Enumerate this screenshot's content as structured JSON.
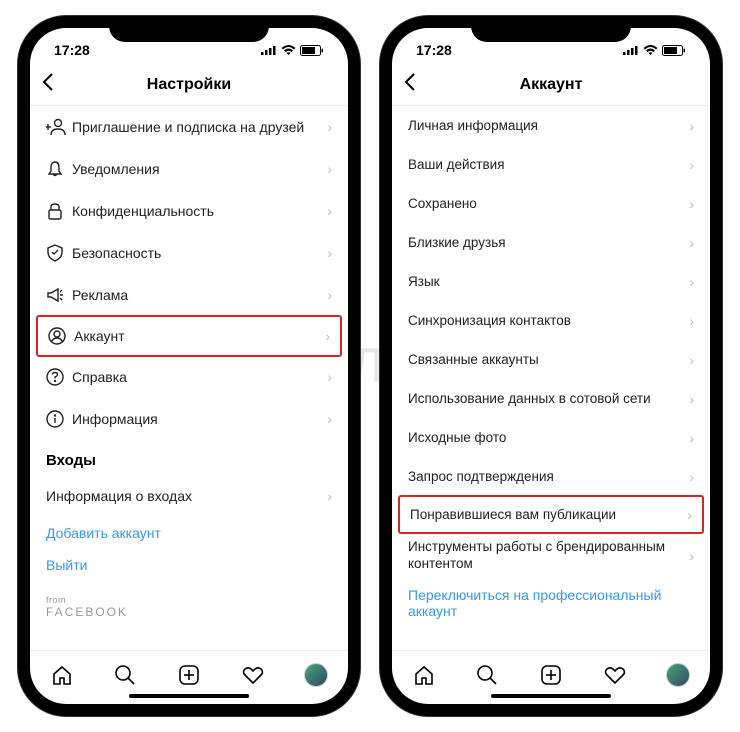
{
  "watermark": "ЯБЛЫК",
  "status": {
    "time": "17:28"
  },
  "left": {
    "nav_title": "Настройки",
    "rows": {
      "invite": "Приглашение и подписка на друзей",
      "notifications": "Уведомления",
      "privacy": "Конфиденциальность",
      "security": "Безопасность",
      "ads": "Реклама",
      "account": "Аккаунт",
      "help": "Справка",
      "about": "Информация"
    },
    "logins_header": "Входы",
    "login_info": "Информация о входах",
    "add_account": "Добавить аккаунт",
    "signout": "Выйти",
    "from": "from",
    "facebook": "FACEBOOK"
  },
  "right": {
    "nav_title": "Аккаунт",
    "rows": {
      "personal": "Личная информация",
      "activity": "Ваши действия",
      "saved": "Сохранено",
      "close_friends": "Близкие друзья",
      "language": "Язык",
      "contacts": "Синхронизация контактов",
      "linked": "Связанные аккаунты",
      "cellular": "Использование данных в сотовой сети",
      "original": "Исходные фото",
      "verify": "Запрос подтверждения",
      "liked": "Понравившиеся вам публикации",
      "branded": "Инструменты работы с брендированным контентом"
    },
    "switch_pro": "Переключиться на профессиональный аккаунт"
  }
}
